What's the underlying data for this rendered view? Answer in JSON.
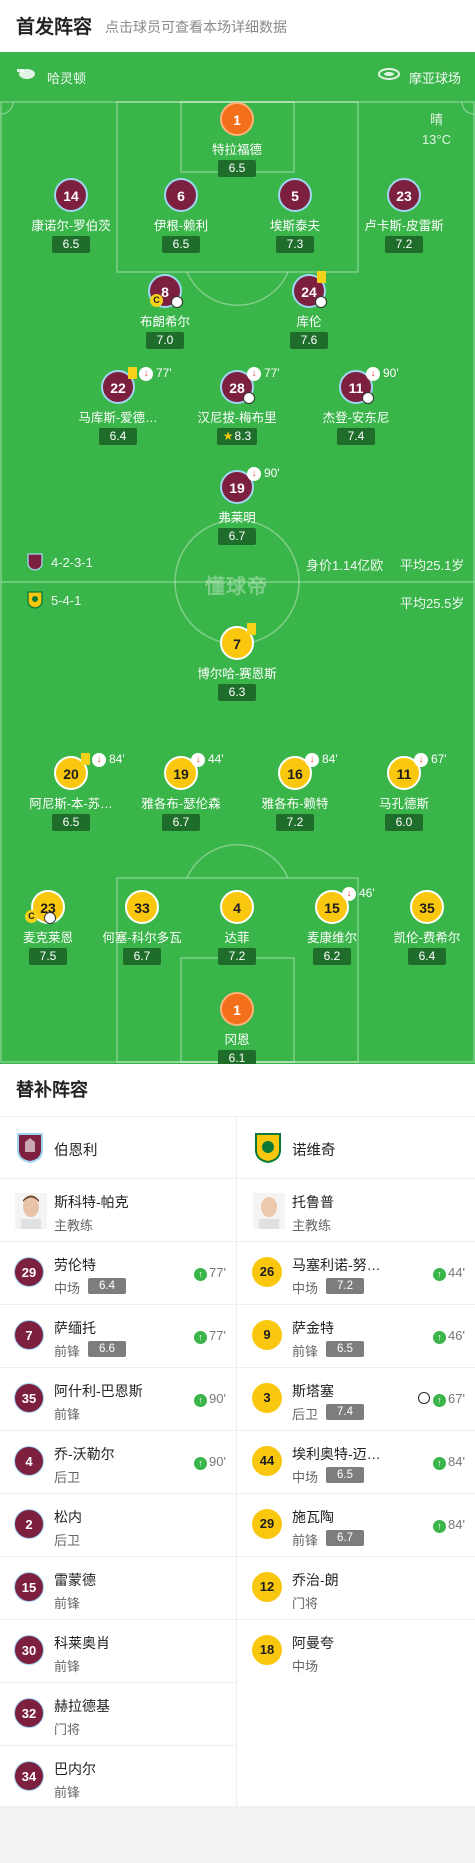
{
  "header": {
    "title": "首发阵容",
    "subtitle": "点击球员可查看本场详细数据"
  },
  "pitch": {
    "home_team": "哈灵顿",
    "venue": "摩亚球场",
    "weather": "晴",
    "temperature": "13°C",
    "home_formation": "4-2-3-1",
    "home_value": "身价1.14亿欧",
    "home_avg_age": "平均25.1岁",
    "away_formation": "5-4-1",
    "away_avg_age": "平均25.5岁",
    "watermark": "懂球帝",
    "colors": {
      "pitch": "#3ab54a",
      "home": "#7d1f3e",
      "away": "#f9c80e",
      "goalkeeper": "#f36f1b"
    }
  },
  "home_lineup": [
    {
      "num": "1",
      "name": "特拉福德",
      "rating": "6.5",
      "gk": true
    },
    {
      "num": "14",
      "name": "康诺尔-罗伯茨",
      "rating": "6.5"
    },
    {
      "num": "6",
      "name": "伊根-赖利",
      "rating": "6.5"
    },
    {
      "num": "5",
      "name": "埃斯泰夫",
      "rating": "7.3"
    },
    {
      "num": "23",
      "name": "卢卡斯-皮雷斯",
      "rating": "7.2"
    },
    {
      "num": "8",
      "name": "布朗希尔",
      "rating": "7.0",
      "captain": "C"
    },
    {
      "num": "24",
      "name": "库伦",
      "rating": "7.6"
    },
    {
      "num": "22",
      "name": "马库斯-爱德…",
      "rating": "6.4",
      "sub_min": "77'"
    },
    {
      "num": "28",
      "name": "汉尼拔-梅布里",
      "rating": "8.3",
      "sub_min": "77'",
      "star": true
    },
    {
      "num": "11",
      "name": "杰登-安东尼",
      "rating": "7.4",
      "sub_min": "90'"
    },
    {
      "num": "19",
      "name": "弗莱明",
      "rating": "6.7",
      "sub_min": "90'"
    }
  ],
  "away_lineup": [
    {
      "num": "7",
      "name": "博尔哈-赛恩斯",
      "rating": "6.3"
    },
    {
      "num": "20",
      "name": "阿尼斯-本-苏…",
      "rating": "6.5",
      "sub_min": "84'"
    },
    {
      "num": "19",
      "name": "雅各布-瑟伦森",
      "rating": "6.7",
      "sub_min": "44'"
    },
    {
      "num": "16",
      "name": "雅各布-赖特",
      "rating": "7.2",
      "sub_min": "84'"
    },
    {
      "num": "11",
      "name": "马孔德斯",
      "rating": "6.0",
      "sub_min": "67'"
    },
    {
      "num": "23",
      "name": "麦克莱恩",
      "rating": "7.5",
      "captain": "C"
    },
    {
      "num": "33",
      "name": "何塞-科尔多瓦",
      "rating": "6.7"
    },
    {
      "num": "4",
      "name": "达菲",
      "rating": "7.2"
    },
    {
      "num": "15",
      "name": "麦康维尔",
      "rating": "6.2",
      "sub_min": "46'"
    },
    {
      "num": "35",
      "name": "凯伦-费希尔",
      "rating": "6.4"
    },
    {
      "num": "1",
      "name": "冈恩",
      "rating": "6.1",
      "gk": true
    }
  ],
  "subs": {
    "title": "替补阵容",
    "home": {
      "team": "伯恩利",
      "coach": {
        "name": "斯科特-帕克",
        "role": "主教练"
      },
      "players": [
        {
          "num": "29",
          "name": "劳伦特",
          "pos": "中场",
          "rating": "6.4",
          "min": "77'"
        },
        {
          "num": "7",
          "name": "萨缅托",
          "pos": "前锋",
          "rating": "6.6",
          "min": "77'"
        },
        {
          "num": "35",
          "name": "阿什利-巴恩斯",
          "pos": "前锋",
          "rating": "",
          "min": "90'"
        },
        {
          "num": "4",
          "name": "乔-沃勒尔",
          "pos": "后卫",
          "rating": "",
          "min": "90'"
        },
        {
          "num": "2",
          "name": "松内",
          "pos": "后卫",
          "rating": "",
          "min": ""
        },
        {
          "num": "15",
          "name": "雷蒙德",
          "pos": "前锋",
          "rating": "",
          "min": ""
        },
        {
          "num": "30",
          "name": "科莱奥肖",
          "pos": "前锋",
          "rating": "",
          "min": ""
        },
        {
          "num": "32",
          "name": "赫拉德基",
          "pos": "门将",
          "rating": "",
          "min": ""
        },
        {
          "num": "34",
          "name": "巴内尔",
          "pos": "前锋",
          "rating": "",
          "min": ""
        }
      ]
    },
    "away": {
      "team": "诺维奇",
      "coach": {
        "name": "托鲁普",
        "role": "主教练"
      },
      "players": [
        {
          "num": "26",
          "name": "马塞利诺-努…",
          "pos": "中场",
          "rating": "7.2",
          "min": "44'"
        },
        {
          "num": "9",
          "name": "萨金特",
          "pos": "前锋",
          "rating": "6.5",
          "min": "46'"
        },
        {
          "num": "3",
          "name": "斯塔塞",
          "pos": "后卫",
          "rating": "7.4",
          "min": "67'",
          "goal": true
        },
        {
          "num": "44",
          "name": "埃利奥特-迈…",
          "pos": "中场",
          "rating": "6.5",
          "min": "84'"
        },
        {
          "num": "29",
          "name": "施瓦陶",
          "pos": "前锋",
          "rating": "6.7",
          "min": "84'"
        },
        {
          "num": "12",
          "name": "乔治-朗",
          "pos": "门将",
          "rating": "",
          "min": ""
        },
        {
          "num": "18",
          "name": "阿曼夸",
          "pos": "中场",
          "rating": "",
          "min": ""
        }
      ]
    }
  }
}
